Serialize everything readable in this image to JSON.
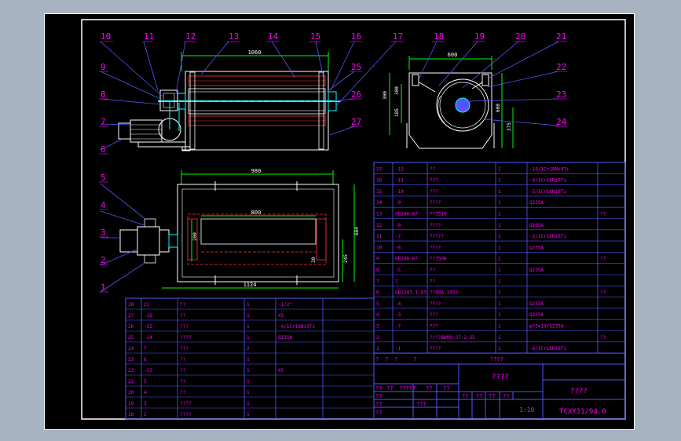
{
  "part_numbers": {
    "top_left": [
      "10",
      "11",
      "12",
      "13",
      "14",
      "15",
      "16",
      "17"
    ],
    "top_right": [
      "18",
      "19",
      "20",
      "21"
    ],
    "left_upper": [
      "9",
      "8",
      "7",
      "6"
    ],
    "right_upper": [
      "25",
      "26",
      "27",
      "22",
      "23",
      "24"
    ],
    "left_lower": [
      "5",
      "4",
      "3",
      "2",
      "1"
    ]
  },
  "dimensions": {
    "front_width": "1060",
    "side_width": "600",
    "side_height": "600",
    "side_h1": "300",
    "side_h2": "300",
    "side_h3": "185",
    "side_h4": "375",
    "plan_outer": "980",
    "plan_inner": "800",
    "plan_total": "1124",
    "plan_height": "684",
    "plan_200": "200",
    "plan_30": "30",
    "plan_245": "245"
  },
  "parts_table_right": [
    {
      "no": "17",
      "code": "-12",
      "name": "??",
      "qty": "1",
      "material": "-10/1Cr18Ni9Ti",
      "note": ""
    },
    {
      "no": "16",
      "code": "-11",
      "name": "???",
      "qty": "1",
      "material": "-4/1Cr18Ni9Ti",
      "note": ""
    },
    {
      "no": "15",
      "code": "-10",
      "name": "???",
      "qty": "1",
      "material": "-5/1Cr18Ni9Ti",
      "note": ""
    },
    {
      "no": "14",
      "code": "-9",
      "name": "????",
      "qty": "1",
      "material": "Q235A",
      "note": ""
    },
    {
      "no": "13",
      "code": "GB288-87",
      "name": "??3510",
      "qty": "1",
      "material": "",
      "note": "??"
    },
    {
      "no": "12",
      "code": "-8",
      "name": "????",
      "qty": "1",
      "material": "Q235A",
      "note": ""
    },
    {
      "no": "11",
      "code": "-7",
      "name": "?????",
      "qty": "1",
      "material": "-2/1Cr18Ni9Ti",
      "note": ""
    },
    {
      "no": "10",
      "code": "-6",
      "name": "????",
      "qty": "1",
      "material": "Q235A",
      "note": ""
    },
    {
      "no": "9",
      "code": "GB288-87",
      "name": "??3508",
      "qty": "2",
      "material": "",
      "note": "??"
    },
    {
      "no": "8",
      "code": "-5",
      "name": "??",
      "qty": "1",
      "material": "Q235A",
      "note": ""
    },
    {
      "no": "7",
      "code": "1",
      "name": "??",
      "qty": "1",
      "material": "",
      "note": ""
    },
    {
      "no": "6",
      "code": "GB1243.1-83",
      "name": "??08A-1X52",
      "qty": "1",
      "material": "",
      "note": "??"
    },
    {
      "no": "5",
      "code": "-4",
      "name": "????",
      "qty": "1",
      "material": "Q235A",
      "note": ""
    },
    {
      "no": "4",
      "code": "-3",
      "name": "???",
      "qty": "1",
      "material": "Q235A",
      "note": ""
    },
    {
      "no": "3",
      "code": "-7",
      "name": "???",
      "qty": "1",
      "material": "φ73x13/Q235A",
      "note": ""
    },
    {
      "no": "2",
      "code": "",
      "name": "????BW00.37-2-35",
      "qty": "1",
      "material": "",
      "note": "??"
    },
    {
      "no": "1",
      "code": "-1",
      "name": "????",
      "qty": "1",
      "material": "-6/1Cr18Ni9Ti",
      "note": ""
    }
  ],
  "parts_table_left": [
    {
      "no": "28",
      "code": "21",
      "name": "??",
      "qty": "1",
      "material": "-1/2\"",
      "note": ""
    },
    {
      "no": "27",
      "code": "-16",
      "name": "??",
      "qty": "1",
      "material": "45",
      "note": ""
    },
    {
      "no": "26",
      "code": "-15",
      "name": "???",
      "qty": "1",
      "material": "-4/1Cr18Ni9Ti",
      "note": ""
    },
    {
      "no": "25",
      "code": "-14",
      "name": "????",
      "qty": "1",
      "material": "Q235A",
      "note": ""
    },
    {
      "no": "24",
      "code": "7",
      "name": "???",
      "qty": "2",
      "material": "",
      "note": ""
    },
    {
      "no": "23",
      "code": "6",
      "name": "??",
      "qty": "1",
      "material": "",
      "note": ""
    },
    {
      "no": "22",
      "code": "-13",
      "name": "??",
      "qty": "1",
      "material": "45",
      "note": ""
    },
    {
      "no": "21",
      "code": "5",
      "name": "??",
      "qty": "1",
      "material": "",
      "note": ""
    },
    {
      "no": "20",
      "code": "4",
      "name": "??",
      "qty": "1",
      "material": "",
      "note": ""
    },
    {
      "no": "19",
      "code": "3",
      "name": "????",
      "qty": "1",
      "material": "",
      "note": ""
    },
    {
      "no": "18",
      "code": "2",
      "name": "????",
      "qty": "1",
      "material": "",
      "note": ""
    }
  ],
  "table_header_row": [
    "?",
    "?",
    "?",
    "?",
    "????"
  ],
  "title_block": {
    "product_name": "????",
    "drawing_title": "????",
    "drawing_number": "TCXY31/94.0",
    "scale": "1:10",
    "sign_labels": [
      "??",
      "??",
      "?????",
      "??",
      "??"
    ],
    "sign_labels2": [
      "??",
      "??",
      "??",
      "??"
    ],
    "row_labels": [
      "??",
      "??",
      "??"
    ],
    "mid_label": "???",
    "scale_labels": [
      "?",
      "?",
      "?",
      "?",
      "?",
      "?"
    ]
  },
  "colors": {
    "frame": "#ffffff",
    "leader": "#5555ff",
    "label": "#ff00ff",
    "dimension": "#00ff00",
    "outline": "#ffffff",
    "hidden": "#ff3333",
    "cyan": "#00ffff",
    "yellow": "#ffff00",
    "table_line": "#5555ff",
    "table_text": "#ff00ff"
  }
}
